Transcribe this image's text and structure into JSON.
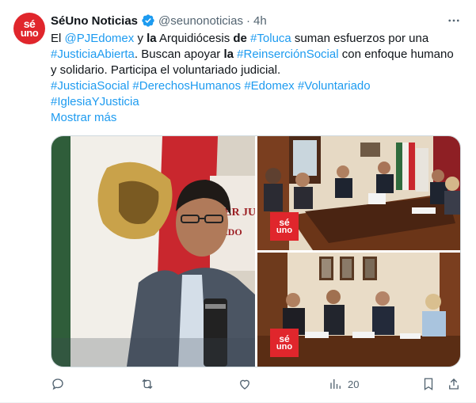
{
  "author": {
    "display_name": "SéUno Noticias",
    "handle": "@seunonoticias",
    "separator": "·",
    "time": "4h",
    "avatar_text_1": "sé",
    "avatar_text_2": "uno"
  },
  "tweet": {
    "t1": "El ",
    "mention": "@PJEdomex",
    "t2": " y ",
    "t3": "la",
    "t4": " Arquidiócesis ",
    "t5": "de",
    "t6": " ",
    "tag_toluca": "#Toluca",
    "t7": " suman esfuerzos por una ",
    "tag_justicia_abierta": "#JusticiaAbierta",
    "t8": ". Buscan apoyar ",
    "t9": "la",
    "t10": " ",
    "tag_reinsercion": "#ReinserciónSocial",
    "t11": " con enfoque humano y solidario. Participa el voluntariado judicial.",
    "hashtags": [
      "#JusticiaSocial",
      "#DerechosHumanos",
      "#Edomex",
      "#Voluntariado",
      "#IglesiaYJusticia"
    ],
    "show_more": "Mostrar más"
  },
  "media": {
    "badge_text_1": "sé",
    "badge_text_2": "uno"
  },
  "actions": {
    "views": "20"
  },
  "colors": {
    "link": "#1d9bf0",
    "brand_red": "#e0262c",
    "muted": "#536471"
  },
  "icons": [
    "verified-badge-icon",
    "more-options-icon",
    "reply-icon",
    "retweet-icon",
    "like-icon",
    "views-icon",
    "bookmark-icon",
    "share-icon"
  ]
}
